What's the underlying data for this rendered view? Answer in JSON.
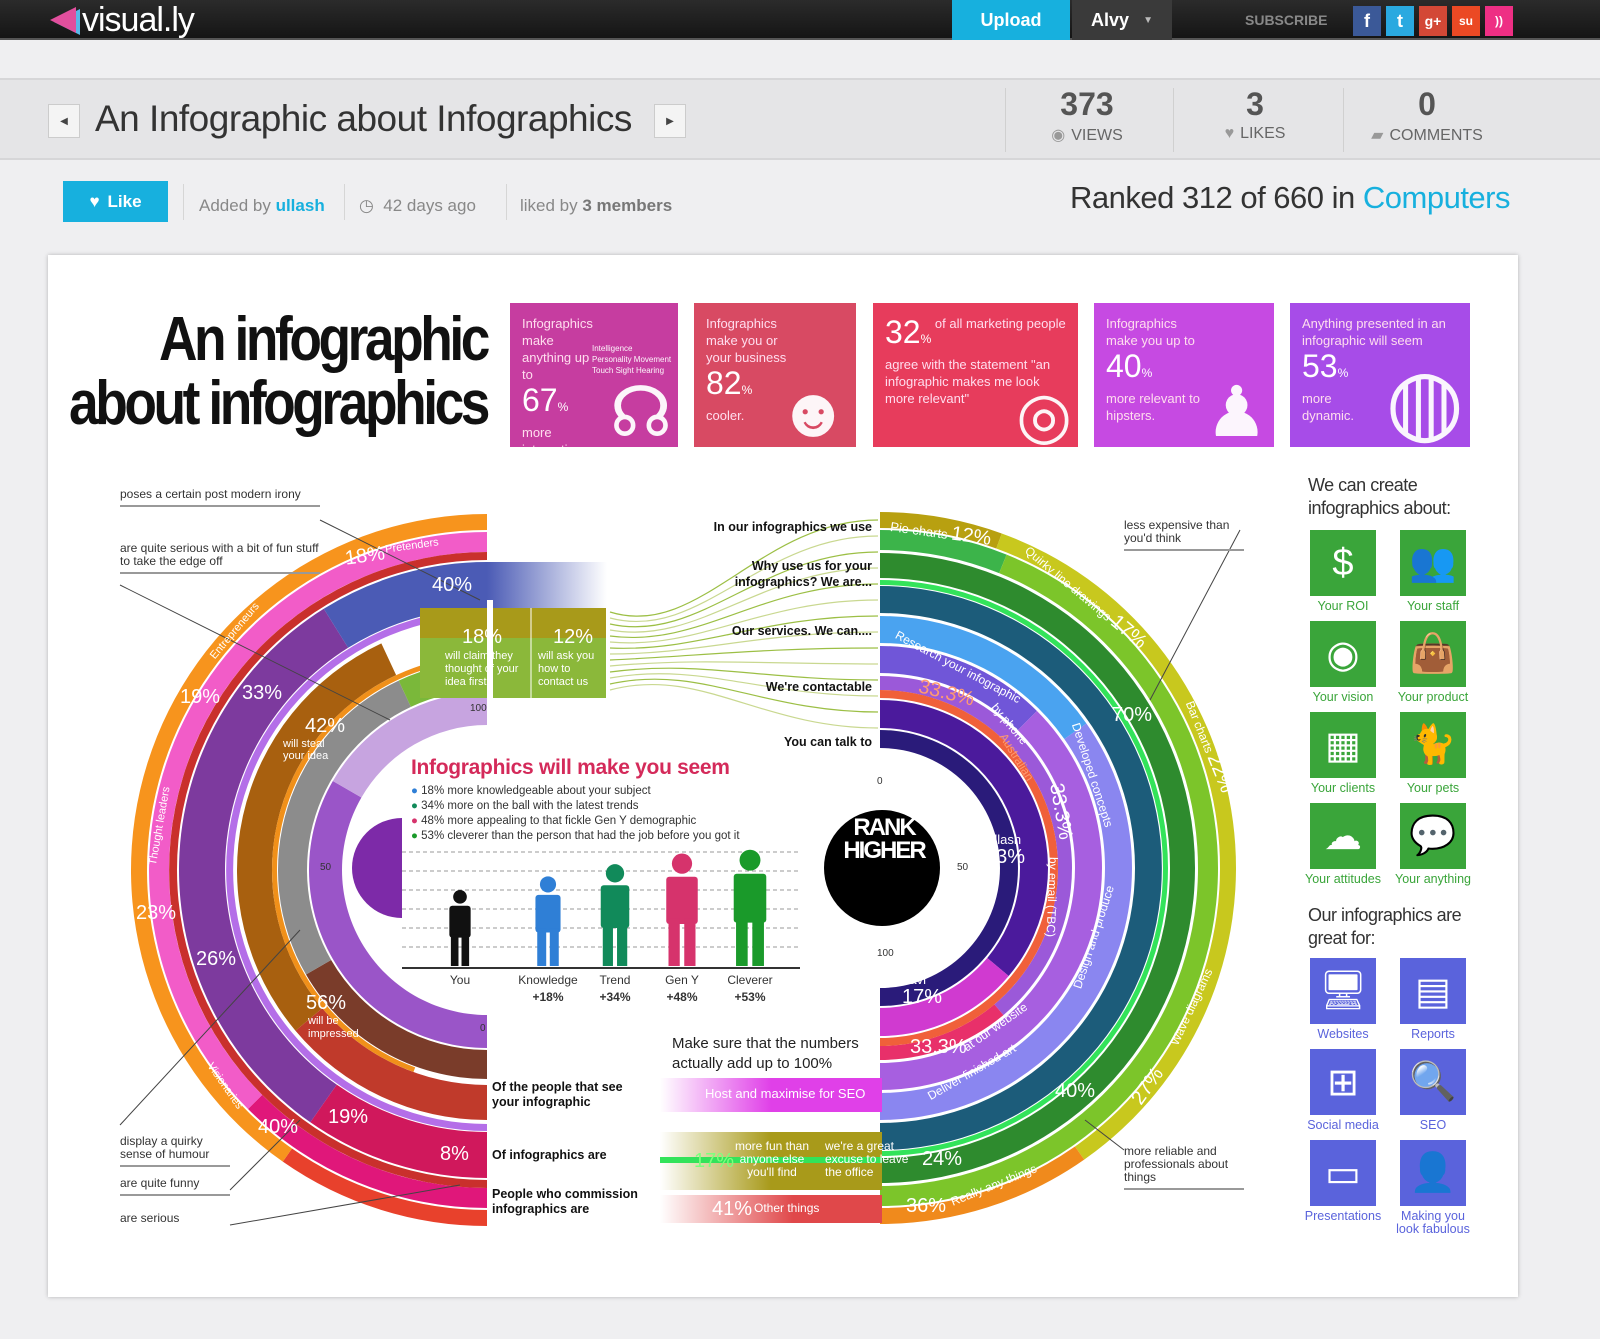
{
  "colors": {
    "accent": "#17b0de",
    "header_bg": "#1e1e1e"
  },
  "header": {
    "logo": "visual.ly",
    "upload": "Upload",
    "user": "Alvy",
    "subscribe": "SUBSCRIBE",
    "social": [
      {
        "icon": "facebook-icon",
        "glyph": "f"
      },
      {
        "icon": "twitter-icon",
        "glyph": "t"
      },
      {
        "icon": "google-plus-icon",
        "glyph": "g+"
      },
      {
        "icon": "stumbleupon-icon",
        "glyph": "su"
      },
      {
        "icon": "rss-icon",
        "glyph": "))"
      }
    ]
  },
  "title_bar": {
    "title": "An Infographic about Infographics",
    "stats": [
      {
        "value": "373",
        "label": "VIEWS",
        "icon": "eye-icon"
      },
      {
        "value": "3",
        "label": "LIKES",
        "icon": "heart-icon"
      },
      {
        "value": "0",
        "label": "COMMENTS",
        "icon": "speech-bubble-icon"
      }
    ]
  },
  "meta": {
    "like": "Like",
    "added_by": "Added by",
    "author": "ullash",
    "time": "42 days ago",
    "liked_by": "liked by",
    "liked_count": "3 members",
    "rank": "Ranked 312 of 660 in",
    "category": "Computers"
  },
  "infographic": {
    "title1": "An infographic",
    "title2": "about infographics",
    "tiles": [
      {
        "pre": "Infographics make anything up to",
        "value": "67",
        "post": "more interesting.",
        "extra": "Intelligence Personality Movement Touch Sight Hearing"
      },
      {
        "pre": "Infographics make you or your business",
        "value": "82",
        "post": "cooler."
      },
      {
        "pre": "of all marketing people agree with the statement \"an infographic makes me look more relevant\"",
        "value": "32"
      },
      {
        "pre": "Infographics make you up to",
        "value": "40",
        "post": "more relevant to hipsters."
      },
      {
        "pre": "Anything presented in an infographic will seem",
        "value": "53",
        "post": "more dynamic."
      }
    ],
    "left_annotations": [
      "poses a certain post modern irony",
      "are quite serious with a bit of fun stuff to take the edge off",
      "display a quirky sense of humour",
      "are quite funny",
      "are serious"
    ],
    "left_labels": {
      "pretenders": "Pretenders",
      "p18": "18%",
      "p40": "40%",
      "entrepreneurs": "Entrepreneurs",
      "p19": "19%",
      "p33": "33%",
      "p42": "42%",
      "steal": "will steal your idea",
      "c18": "18%",
      "claim": "will claim they thought of your idea first",
      "c12": "12%",
      "ask": "will ask you how to contact us",
      "thought": "Thought leaders",
      "p23": "23%",
      "p26": "26%",
      "p56": "56%",
      "impressed": "will be impressed",
      "visionaries": "Visionaries",
      "b40": "40%",
      "b19": "19%",
      "b8": "8%",
      "ax100": "100",
      "ax50": "50",
      "ax0": "0"
    },
    "row_labels": [
      "Of the people that see your infographic",
      "Of infographics are",
      "People who commission infographics are"
    ],
    "right_rows": [
      "In our infographics we use",
      "Why use us for your infographics? We are...",
      "Our services. We can....",
      "We're contactable",
      "You can talk to"
    ],
    "right_labels": {
      "pie": "Pie charts",
      "pie_v": "12%",
      "quirky": "Quirky line drawings",
      "quirky_v": "17%",
      "bar": "Bar charts",
      "bar_v": "22%",
      "v70": "70%",
      "research": "Research your infographic",
      "v333a": "33.3%",
      "phone": "by phone",
      "australian": "Australian",
      "developed": "Developed concepts",
      "v333b": "33.3%",
      "email": "by email (TBC)",
      "design": "Design and produce",
      "ullash": "Ullash",
      "ullash_v": "83%",
      "ravi": "Ravi",
      "ravi_v": "17%",
      "v333c": "33.3%",
      "website": "at our website",
      "deliver": "Deliver finished art",
      "seo": "Host and maximise for SEO",
      "v40": "40%",
      "v27": "27%",
      "wave": "Wave diagrams",
      "fun": "more fun than anyone else you'll find",
      "fun_v": "17%",
      "excuse": "we're a great excuse to leave the office",
      "excuse_v": "24%",
      "other_v": "41%",
      "other": "Other things",
      "any_v": "36%",
      "any": "Really any things",
      "ax0": "0",
      "ax50": "50",
      "ax100": "100"
    },
    "right_annotations": [
      "less expensive than you'd think",
      "more reliable and professionals about things"
    ],
    "note": "Make sure that the numbers actually add up to 100%",
    "rank_logo": [
      "RANK",
      "HIGHER"
    ],
    "seem_chart": {
      "title": "Infographics will make you seem",
      "legend": [
        {
          "text": "18% more knowledgeable about your subject",
          "color": "#2f7fd6"
        },
        {
          "text": "34% more on the ball with the latest trends",
          "color": "#118a5a"
        },
        {
          "text": "48% more appealing to that fickle Gen Y demographic",
          "color": "#d6336c"
        },
        {
          "text": "53% cleverer than the person that had the job before you got it",
          "color": "#1a9a2a"
        }
      ],
      "figures": [
        {
          "name": "You",
          "delta": "",
          "value": 0,
          "color": "#111111"
        },
        {
          "name": "Knowledge",
          "delta": "+18%",
          "value": 18,
          "color": "#2f7fd6"
        },
        {
          "name": "Trend",
          "delta": "+34%",
          "value": 34,
          "color": "#118a5a"
        },
        {
          "name": "Gen Y",
          "delta": "+48%",
          "value": 48,
          "color": "#d6336c"
        },
        {
          "name": "Cleverer",
          "delta": "+53%",
          "value": 53,
          "color": "#1a9a2a"
        }
      ]
    },
    "create_heading": "We can create infographics about:",
    "create_items": [
      {
        "label": "Your ROI",
        "icon": "money-bag-icon",
        "glyph": "$"
      },
      {
        "label": "Your staff",
        "icon": "people-icon",
        "glyph": "👥"
      },
      {
        "label": "Your vision",
        "icon": "eye-icon",
        "glyph": "◉"
      },
      {
        "label": "Your product",
        "icon": "shopping-bag-icon",
        "glyph": "👜"
      },
      {
        "label": "Your clients",
        "icon": "building-icon",
        "glyph": "▦"
      },
      {
        "label": "Your pets",
        "icon": "cat-icon",
        "glyph": "🐈"
      },
      {
        "label": "Your attitudes",
        "icon": "cloud-icon",
        "glyph": "☁"
      },
      {
        "label": "Your anything",
        "icon": "speech-bubbles-icon",
        "glyph": "💬"
      }
    ],
    "great_heading": "Our infographics are great for:",
    "great_items": [
      {
        "label": "Websites",
        "icon": "monitor-icon",
        "glyph": "🖥"
      },
      {
        "label": "Reports",
        "icon": "document-icon",
        "glyph": "▤"
      },
      {
        "label": "Social media",
        "icon": "social-icon",
        "glyph": "⊞"
      },
      {
        "label": "SEO",
        "icon": "magnifier-icon",
        "glyph": "🔍"
      },
      {
        "label": "Presentations",
        "icon": "easel-icon",
        "glyph": "▭"
      },
      {
        "label": "Making you look fabulous",
        "icon": "person-icon",
        "glyph": "👤"
      }
    ]
  }
}
